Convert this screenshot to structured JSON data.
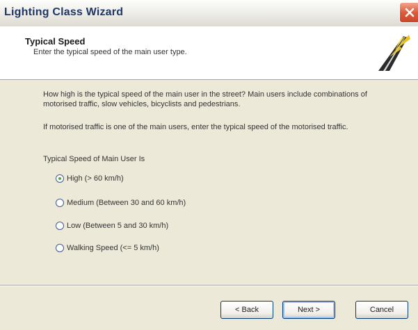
{
  "window": {
    "title": "Lighting Class Wizard"
  },
  "header": {
    "title": "Typical Speed",
    "subtitle": "Enter the typical speed of the main user type."
  },
  "body": {
    "paragraph1": "How high is the typical speed of the main user in the street? Main users include combinations of motorised traffic, slow vehicles, bicyclists and pedestrians.",
    "paragraph2": "If motorised traffic is one of the main users, enter the typical speed of the motorised traffic.",
    "speed_label": "Typical Speed of Main User Is",
    "options": [
      {
        "label": "High (> 60 km/h)",
        "selected": true
      },
      {
        "label": "Medium (Between 30 and 60 km/h)",
        "selected": false
      },
      {
        "label": "Low (Between 5 and 30 km/h)",
        "selected": false
      },
      {
        "label": "Walking Speed (<= 5 km/h)",
        "selected": false
      }
    ]
  },
  "buttons": {
    "back": "< Back",
    "next": "Next >",
    "cancel": "Cancel"
  },
  "icons": {
    "close": "close-icon",
    "wizard": "wizard-road-icon",
    "radio": "radio-icon"
  }
}
